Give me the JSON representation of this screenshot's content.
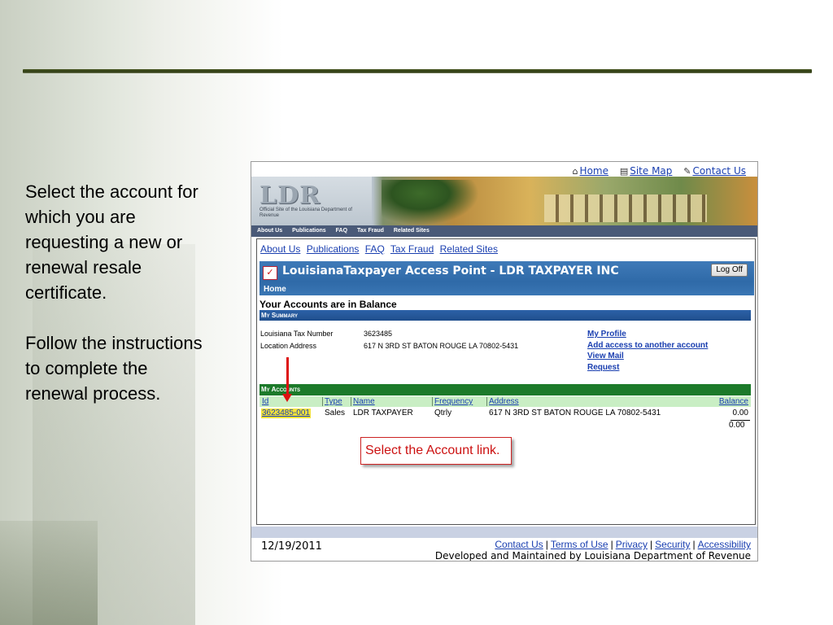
{
  "slide": {
    "paragraphs": [
      "Select the account for which you are requesting a new or renewal resale certificate.",
      "Follow the instructions to complete the renewal process."
    ]
  },
  "util_links": [
    "Home",
    "Site Map",
    "Contact Us"
  ],
  "banner": {
    "logo": "LDR",
    "subtitle": "Official Site of the Louisiana Department of Revenue"
  },
  "main_nav": [
    "About Us",
    "Publications",
    "FAQ",
    "Tax Fraud",
    "Related Sites"
  ],
  "sub_nav": [
    "About Us",
    "Publications",
    "FAQ",
    "Tax Fraud",
    "Related Sites"
  ],
  "app": {
    "title": "LouisianaTaxpayer Access Point - LDR TAXPAYER INC",
    "logoff": "Log Off",
    "home": "Home",
    "balance_title": "Your Accounts are in Balance",
    "summary_header": "My Summary"
  },
  "summary": {
    "tax_number_label": "Louisiana Tax Number",
    "tax_number": "3623485",
    "address_label": "Location Address",
    "address": "617 N 3RD ST BATON ROUGE LA 70802-5431"
  },
  "profile_links": [
    "My Profile",
    "Add access to another account",
    "View Mail",
    "Request"
  ],
  "accounts": {
    "header": "My Accounts",
    "columns": [
      "Id",
      "Type",
      "Name",
      "Frequency",
      "Address",
      "Balance"
    ],
    "row": {
      "id": "3623485-001",
      "type": "Sales",
      "name": "LDR TAXPAYER",
      "frequency": "Qtrly",
      "address": "617 N 3RD ST BATON ROUGE LA 70802-5431",
      "balance": "0.00"
    },
    "total": "0.00"
  },
  "callout": "Select the Account link.",
  "footer": {
    "date": "12/19/2011",
    "links": [
      "Contact Us",
      "Terms of Use",
      "Privacy",
      "Security",
      "Accessibility"
    ],
    "credit": "Developed and Maintained by Louisiana Department of Revenue"
  }
}
